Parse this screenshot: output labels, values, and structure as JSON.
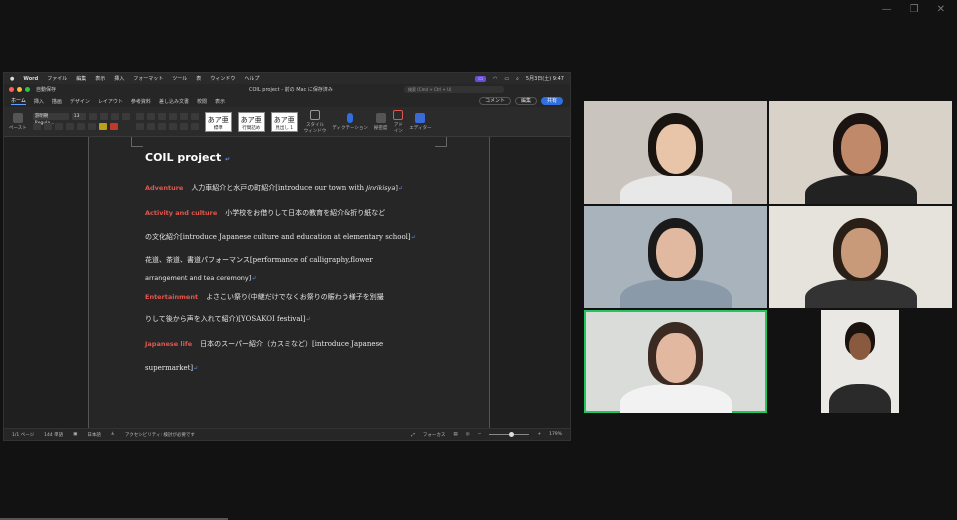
{
  "window_controls": [
    "—",
    "❐",
    "✕"
  ],
  "menubar": {
    "app": "Word",
    "items": [
      "ファイル",
      "編集",
      "表示",
      "挿入",
      "フォーマット",
      "ツール",
      "表",
      "ウィンドウ",
      "ヘルプ"
    ],
    "datetime": "5月3日(土) 9:47"
  },
  "titlebar": {
    "autosave": "自動保存",
    "doc_title": "COIL project - 前の Mac に保存済み",
    "search_placeholder": "検索 (Cmd + Ctrl + U)"
  },
  "tabs": {
    "items": [
      "ホーム",
      "挿入",
      "描画",
      "デザイン",
      "レイアウト",
      "参考資料",
      "差し込み文書",
      "校閲",
      "表示"
    ],
    "active": "ホーム",
    "comment": "コメント",
    "edit": "編集",
    "share": "共有"
  },
  "ribbon": {
    "paste": "ペースト",
    "font": "游明朝 Regula...",
    "size": "13",
    "styles": [
      {
        "glyph": "あア亜",
        "name": "標準"
      },
      {
        "glyph": "あア亜",
        "name": "行間詰め"
      },
      {
        "glyph": "あア亜",
        "name": "見出し 1"
      }
    ],
    "style_pane": "スタイル\nウィンドウ",
    "dictation": "ディクテーション",
    "sensitivity": "秘密度",
    "addins": "アド\nイン",
    "editor": "エディター"
  },
  "document": {
    "title": "COIL project",
    "para_mark": "↵",
    "lines": [
      {
        "head": "Adventure",
        "text": "人力車紹介と水戸の町紹介[introduce our town with ",
        "italic": "Jinrikisya",
        "tail": "]"
      },
      {
        "head": "Activity and culture",
        "text": "小学校をお借りして日本の教育を紹介&折り紙など"
      },
      {
        "text": "の文化紹介[introduce Japanese culture and education at elementary school]"
      },
      {
        "text": "花道、茶道、書道パフォーマンス[performance of calligraphy,flower"
      },
      {
        "text": "arrangement and tea ceremony]"
      },
      {
        "head": "Entertainment",
        "text": "よさこい祭り(中継だけでなくお祭りの賑わう様子を別撮"
      },
      {
        "text": "りして後から声を入れて紹介)[YOSAKOI festival]"
      },
      {
        "head": "Japanese life",
        "text": "日本のスーパー紹介（カスミなど）[introduce Japanese"
      },
      {
        "text": "supermarket]"
      }
    ]
  },
  "statusbar": {
    "page": "1/1 ページ",
    "words": "144 単語",
    "lang": "日本語",
    "accessibility": "アクセシビリティ: 検討が必要です",
    "focus": "フォーカス",
    "zoom": "179%",
    "zoom_level": 0.55
  },
  "gallery": {
    "participants": [
      {
        "id": "p1",
        "bg": "#c9c4be",
        "hair": "#1a1410",
        "skin": "#e8c4a8",
        "shirt": "#e8e8e8"
      },
      {
        "id": "p2",
        "bg": "#d8d2c8",
        "hair": "#1b1311",
        "skin": "#c08a6a",
        "shirt": "#222222"
      },
      {
        "id": "p3",
        "bg": "#a9b3bc",
        "hair": "#1a1a1a",
        "skin": "#e0b9a0",
        "shirt": "#8a9aa8"
      },
      {
        "id": "p4",
        "bg": "#e6e2dc",
        "hair": "#2a1f17",
        "skin": "#c89a7a",
        "shirt": "#333333"
      },
      {
        "id": "p5",
        "bg": "#d9dcd8",
        "hair": "#3a2a22",
        "skin": "#e2b8a0",
        "shirt": "#f2f2f2"
      },
      {
        "id": "p6",
        "bg": "#eae8e4",
        "hair": "#1a120e",
        "skin": "#8a5a3e",
        "shirt": "#2a2a2a"
      }
    ],
    "active_speaker": "p5"
  }
}
